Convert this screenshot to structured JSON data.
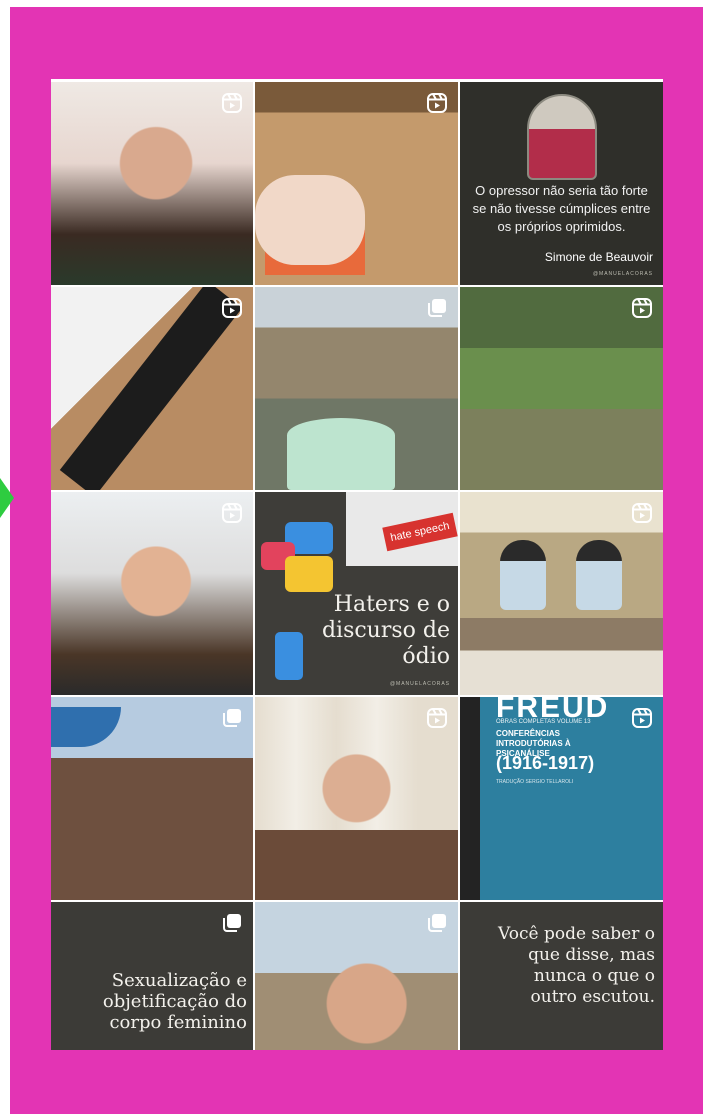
{
  "colors": {
    "frame_background": "#e334b4",
    "arrow": "#2ecc40",
    "tile_dark": "#3c3b37"
  },
  "grid": {
    "tiles": [
      {
        "name": "tile-selfie-1",
        "badge": "reels-icon"
      },
      {
        "name": "tile-box-opening",
        "badge": "reels-icon"
      },
      {
        "name": "tile-beauvoir-quote",
        "badge": "",
        "quote": "O opressor não seria tão forte se não tivesse cúmplices entre os próprios oprimidos.",
        "author": "Simone de Beauvoir",
        "handle": "@MANUELACORAS"
      },
      {
        "name": "tile-package",
        "badge": "reels-icon"
      },
      {
        "name": "tile-window-mug",
        "badge": "carousel-icon"
      },
      {
        "name": "tile-rice-terraces",
        "badge": "reels-icon"
      },
      {
        "name": "tile-selfie-2",
        "badge": "reels-icon"
      },
      {
        "name": "tile-haters",
        "badge": "",
        "keyboard_key": "hate speech",
        "title": "Haters e o discurso de ódio",
        "handle": "@MANUELACORAS"
      },
      {
        "name": "tile-office-scene",
        "badge": "reels-icon"
      },
      {
        "name": "tile-beach-selfie",
        "badge": "carousel-icon"
      },
      {
        "name": "tile-selfie-3",
        "badge": "reels-icon"
      },
      {
        "name": "tile-freud-book",
        "badge": "reels-icon",
        "book_title": "FREUD",
        "book_subtitle_small": "OBRAS COMPLETAS VOLUME 13",
        "book_subtitle": "CONFERÊNCIAS INTRODUTÓRIAS À PSICANÁLISE",
        "book_years": "(1916-1917)",
        "book_translation": "TRADUÇÃO SERGIO TELLAROLI"
      },
      {
        "name": "tile-sexualizacao",
        "badge": "carousel-icon",
        "title": "Sexualização e objetificação do corpo feminino"
      },
      {
        "name": "tile-selfie-4",
        "badge": "carousel-icon"
      },
      {
        "name": "tile-voce-pode-saber",
        "badge": "",
        "title": "Você pode saber o que disse, mas nunca o que o outro escutou."
      }
    ]
  }
}
